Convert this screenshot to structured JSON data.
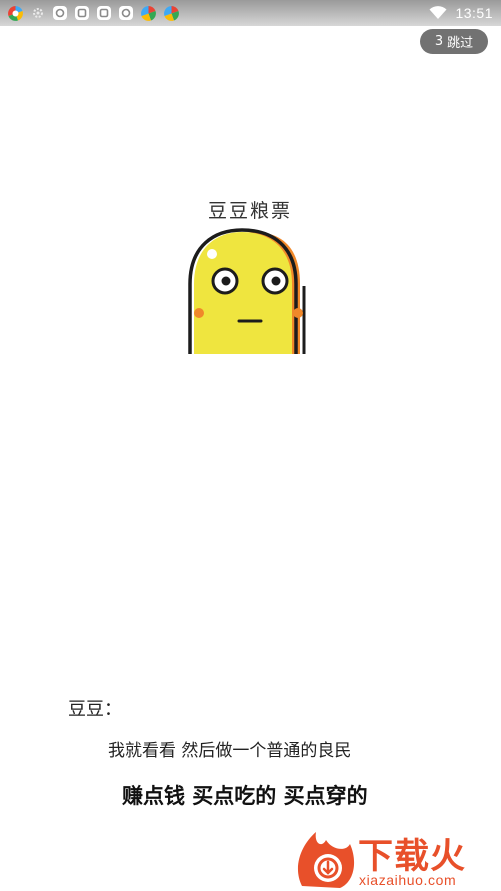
{
  "status_bar": {
    "time": "13:51",
    "notification_icons": [
      "color-app-icon",
      "settings-icon",
      "chat-icon",
      "chat-icon",
      "chat-icon",
      "chat-icon",
      "color-app-icon",
      "color-app-icon"
    ],
    "wifi_icon": "wifi-icon"
  },
  "skip_button": {
    "countdown": "3",
    "label": "跳过"
  },
  "logo": {
    "title": "豆豆粮票",
    "colors": {
      "body": "#efe53f",
      "outline": "#1c1c1c",
      "shadow": "#f0882a",
      "cheek": "#f0882a"
    }
  },
  "dialogue": {
    "speaker": "豆豆：",
    "line_one": "我就看看 然后做一个普通的良民",
    "line_two": "赚点钱 买点吃的 买点穿的"
  },
  "watermark": {
    "brand": "下载火",
    "url": "xiazaihuo.com",
    "color": "#e8502a"
  }
}
